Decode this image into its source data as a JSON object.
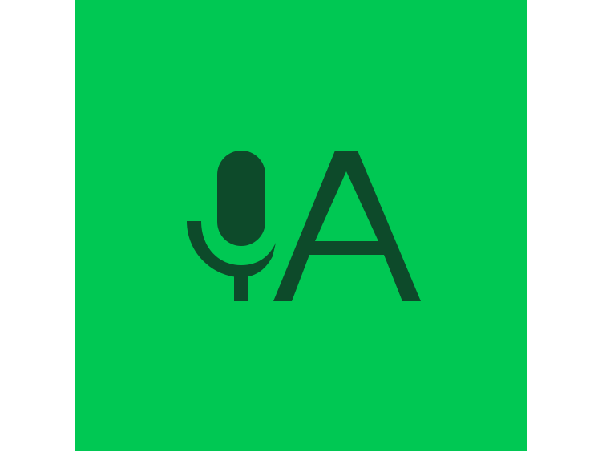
{
  "app_icon": {
    "background_color": "#00c853",
    "glyph_color": "#0d4a2a",
    "glyphs": [
      "microphone-icon",
      "letter-a-glyph"
    ]
  }
}
